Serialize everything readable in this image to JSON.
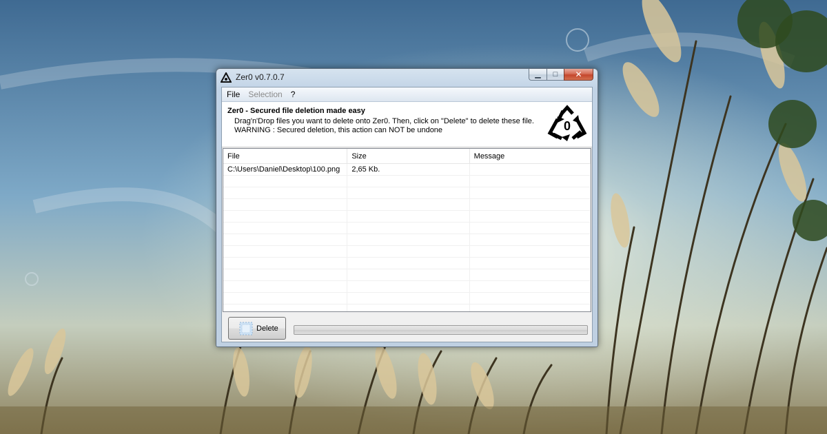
{
  "window": {
    "title": "Zer0 v0.7.0.7",
    "min_glyph": "▁",
    "max_glyph": "□",
    "close_glyph": "✕"
  },
  "menu": {
    "items": [
      {
        "label": "File",
        "enabled": true
      },
      {
        "label": "Selection",
        "enabled": false
      },
      {
        "label": "?",
        "enabled": true
      }
    ]
  },
  "header": {
    "title": "Zer0 - Secured file deletion made easy",
    "line1": "Drag'n'Drop files you want to delete onto Zer0. Then, click on \"Delete\" to delete these file.",
    "line2": "WARNING : Secured deletion, this action can NOT be undone",
    "logo_digit": "0",
    "logo_icon": "recycle-icon"
  },
  "table": {
    "columns": [
      "File",
      "Size",
      "Message"
    ],
    "rows": [
      {
        "file": "C:\\Users\\Daniel\\Desktop\\100.png",
        "size": "2,65 Kb.",
        "message": ""
      }
    ],
    "empty_rows": 12
  },
  "actions": {
    "delete_label": "Delete",
    "progress": 0
  },
  "colors": {
    "accent": "#c4462c"
  }
}
